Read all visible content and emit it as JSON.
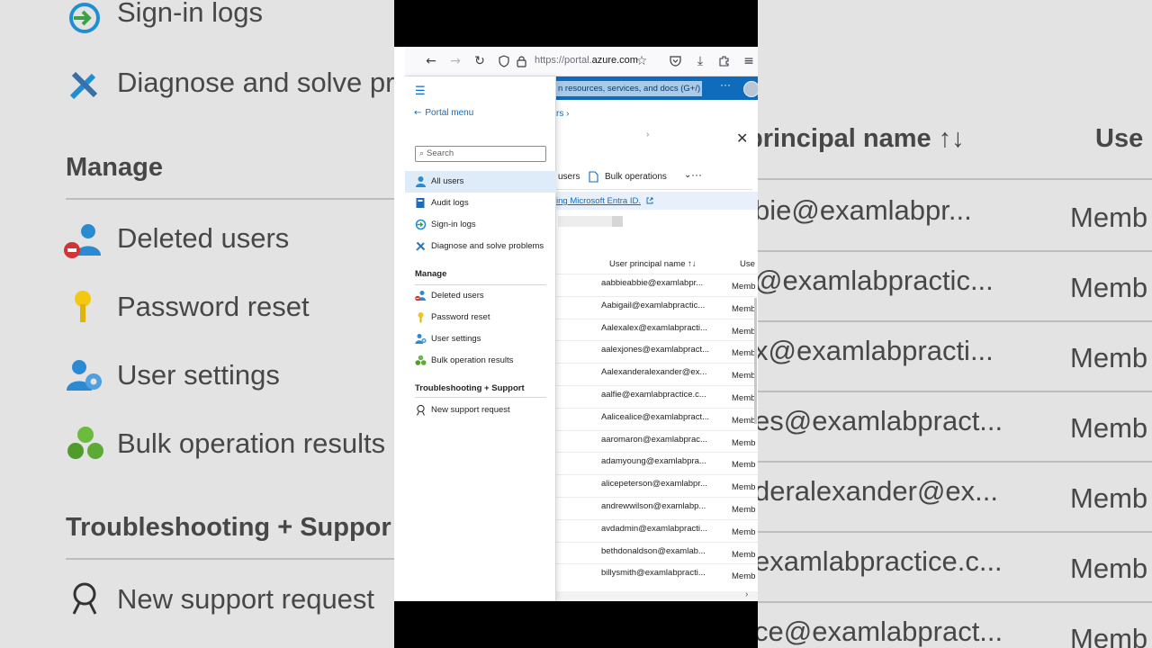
{
  "background_left": {
    "items": [
      "Sign-in logs",
      "Diagnose and solve pro",
      "Manage",
      "Deleted users",
      "Password reset",
      "User settings",
      "Bulk operation results",
      "Troubleshooting + Suppor",
      "New support request"
    ]
  },
  "background_right": {
    "header": "principal name ↑↓",
    "header_type": "Use",
    "rows": [
      "bie@examlabpr...",
      "@examlabpractic...",
      "x@examlabpracti...",
      "es@examlabpract...",
      "deralexander@ex...",
      "examlabpractice.c...",
      "ce@examlabpract..."
    ],
    "type": "Memb"
  },
  "browser": {
    "url_prefix": "https://portal.",
    "url_domain": "azure.com",
    "global_search": "n resources, services, and docs (G+/)",
    "more": "···"
  },
  "page": {
    "breadcrumb": "rs  ›",
    "chevron": "›",
    "close": "✕",
    "cmd_users": "users",
    "cmd_bulk": "Bulk operations",
    "cmd_dots": "···",
    "banner_link": "ing Microsoft Entra ID.",
    "col_upn": "User principal name ↑↓",
    "col_type": "Use",
    "rows": [
      {
        "upn": "aabbieabbie@examlabpr...",
        "type": "Memb"
      },
      {
        "upn": "Aabigail@examlabpractic...",
        "type": "Memb"
      },
      {
        "upn": "Aalexalex@examlabpracti...",
        "type": "Memb"
      },
      {
        "upn": "aalexjones@examlabpract...",
        "type": "Memb"
      },
      {
        "upn": "Aalexanderalexander@ex...",
        "type": "Memb"
      },
      {
        "upn": "aalfie@examlabpractice.c...",
        "type": "Memb"
      },
      {
        "upn": "Aalicealice@examlabpract...",
        "type": "Memb"
      },
      {
        "upn": "aaromaron@examlabprac...",
        "type": "Memb"
      },
      {
        "upn": "adamyoung@examlabpra...",
        "type": "Memb"
      },
      {
        "upn": "alicepeterson@examlabpr...",
        "type": "Memb"
      },
      {
        "upn": "andrewwilson@examlabp...",
        "type": "Memb"
      },
      {
        "upn": "avdadmin@examlabpracti...",
        "type": "Memb"
      },
      {
        "upn": "bethdonaldson@examlab...",
        "type": "Memb"
      },
      {
        "upn": "billysmith@examlabpracti...",
        "type": "Memb"
      }
    ]
  },
  "menu": {
    "hamburger": "☰",
    "portal_menu": "Portal menu",
    "search_placeholder": "Search",
    "items": [
      {
        "label": "All users",
        "icon": "user-icon",
        "active": true
      },
      {
        "label": "Audit logs",
        "icon": "book-icon"
      },
      {
        "label": "Sign-in logs",
        "icon": "signin-icon"
      },
      {
        "label": "Diagnose and solve problems",
        "icon": "wrench-icon"
      }
    ],
    "manage_heading": "Manage",
    "manage_items": [
      {
        "label": "Deleted users",
        "icon": "deleted-user-icon"
      },
      {
        "label": "Password reset",
        "icon": "key-icon"
      },
      {
        "label": "User settings",
        "icon": "user-settings-icon"
      },
      {
        "label": "Bulk operation results",
        "icon": "bulk-icon"
      }
    ],
    "support_heading": "Troubleshooting + Support",
    "support_items": [
      {
        "label": "New support request",
        "icon": "support-icon"
      }
    ]
  },
  "colors": {
    "azure_blue": "#0f6cbd",
    "menu_active": "#deecf9"
  }
}
